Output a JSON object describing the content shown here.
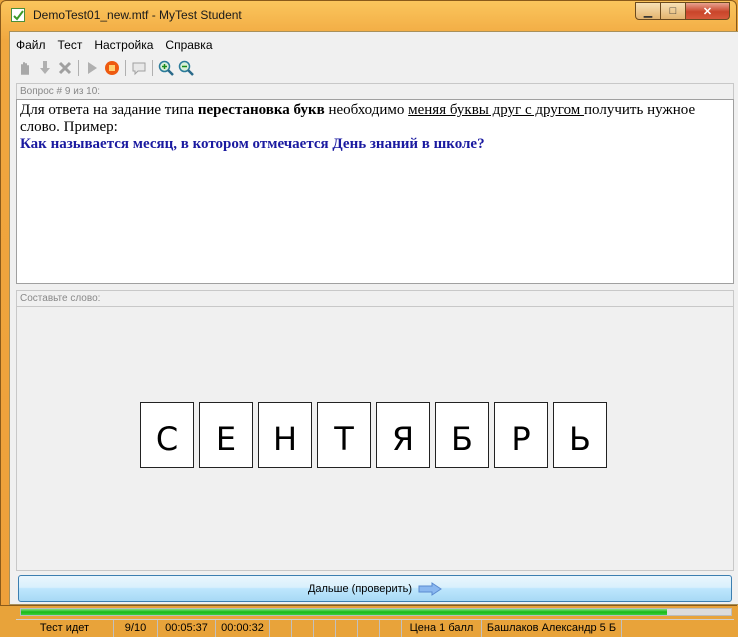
{
  "window": {
    "title": "DemoTest01_new.mtf - MyTest Student",
    "icon": "check-icon"
  },
  "menu": [
    "Файл",
    "Тест",
    "Настройка",
    "Справка"
  ],
  "toolbar": [
    "hand-icon",
    "down-arrow-icon",
    "delete-icon",
    "play-icon",
    "stop-icon",
    "comment-icon",
    "zoom-in-icon",
    "zoom-out-icon"
  ],
  "question": {
    "header": "Вопрос # 9 из 10:",
    "text_1": "Для ответа на задание типа ",
    "text_bold": "перестановка букв",
    "text_2": " необходимо ",
    "text_underline": "меняя буквы друг с другом ",
    "text_3": "получить нужное слово. Пример:",
    "example": "Как называется месяц, в котором отмечается День знаний в школе?"
  },
  "answer": {
    "header": "Составьте слово:",
    "letters": [
      "С",
      "Е",
      "Н",
      "Т",
      "Я",
      "Б",
      "Р",
      "Ь"
    ]
  },
  "next_button": {
    "label": "Дальше (проверить)"
  },
  "progress": {
    "fraction": 0.91,
    "color": "#18b818"
  },
  "status": {
    "state": "Тест идет",
    "count": "9/10",
    "time_total": "00:05:37",
    "time_question": "00:00:32",
    "price": "Цена 1 балл",
    "user": "Башлаков Александр 5 Б"
  }
}
